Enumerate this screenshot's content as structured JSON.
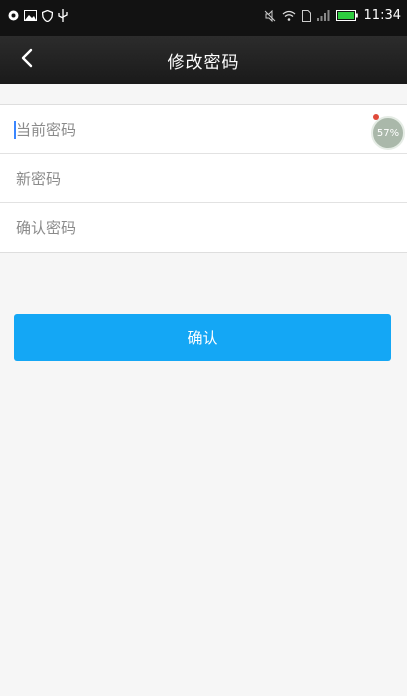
{
  "status_bar": {
    "time": "11:34",
    "icons_left": [
      "vpn-icon",
      "image-icon",
      "shield-icon",
      "usb-icon"
    ],
    "icons_right": [
      "mute-icon",
      "wifi-icon",
      "sim-icon",
      "signal-icon",
      "battery-icon"
    ],
    "battery_color": "#2ecc40"
  },
  "header": {
    "title": "修改密码",
    "back_icon": "chevron-left-icon"
  },
  "form": {
    "current_password_placeholder": "当前密码",
    "new_password_placeholder": "新密码",
    "confirm_password_placeholder": "确认密码"
  },
  "floating_widget": {
    "label": "57%"
  },
  "confirm_button": {
    "label": "确认",
    "color": "#14a7f5"
  }
}
